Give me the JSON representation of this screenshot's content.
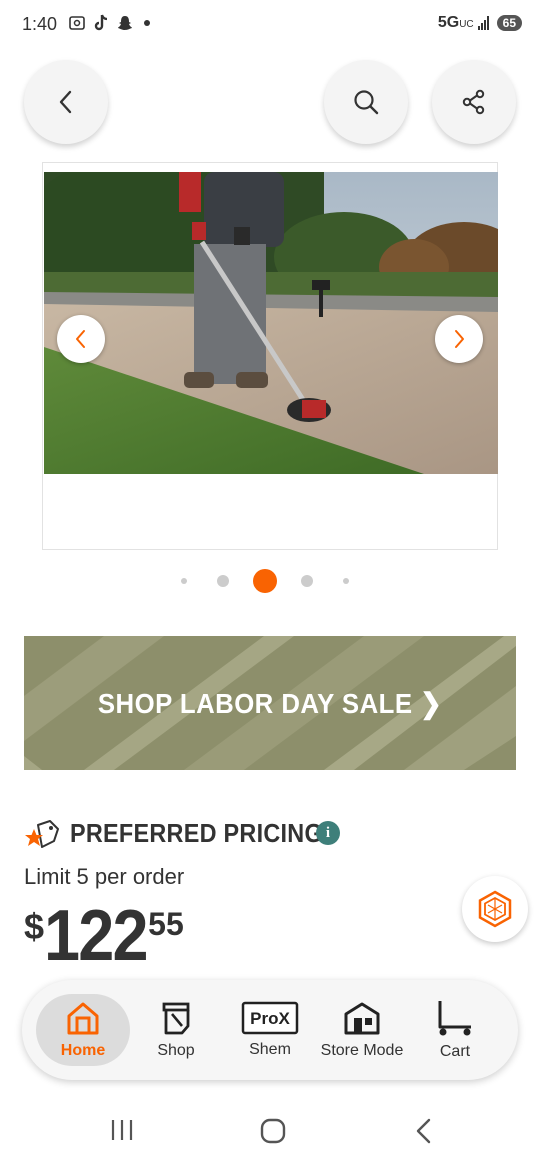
{
  "status_bar": {
    "time": "1:40",
    "network": "5G",
    "network_sub": "UC",
    "battery": "65"
  },
  "carousel": {
    "image_alt": "Person edging grass along a sidewalk with a string trimmer edger attachment",
    "dots_count": 5,
    "active_dot": 3
  },
  "banner": {
    "text": "SHOP LABOR DAY SALE ❯"
  },
  "pricing": {
    "label": "PREFERRED PRICING",
    "info_icon": "i",
    "limit": "Limit 5 per order",
    "currency": "$",
    "dollars": "122",
    "cents": "55"
  },
  "bottom_nav": {
    "items": [
      {
        "label": "Home",
        "icon": "home-icon",
        "active": true
      },
      {
        "label": "Shop",
        "icon": "shop-icon",
        "active": false
      },
      {
        "label": "Shem",
        "icon": "prox-icon",
        "active": false
      },
      {
        "label": "Store Mode",
        "icon": "store-icon",
        "active": false
      },
      {
        "label": "Cart",
        "icon": "cart-icon",
        "active": false
      }
    ],
    "prox_badge": "ProX"
  },
  "colors": {
    "brand_orange": "#f96302",
    "text_dark": "#333333",
    "info_teal": "#3e7f7a",
    "banner_olive": "#8e8f6c"
  }
}
